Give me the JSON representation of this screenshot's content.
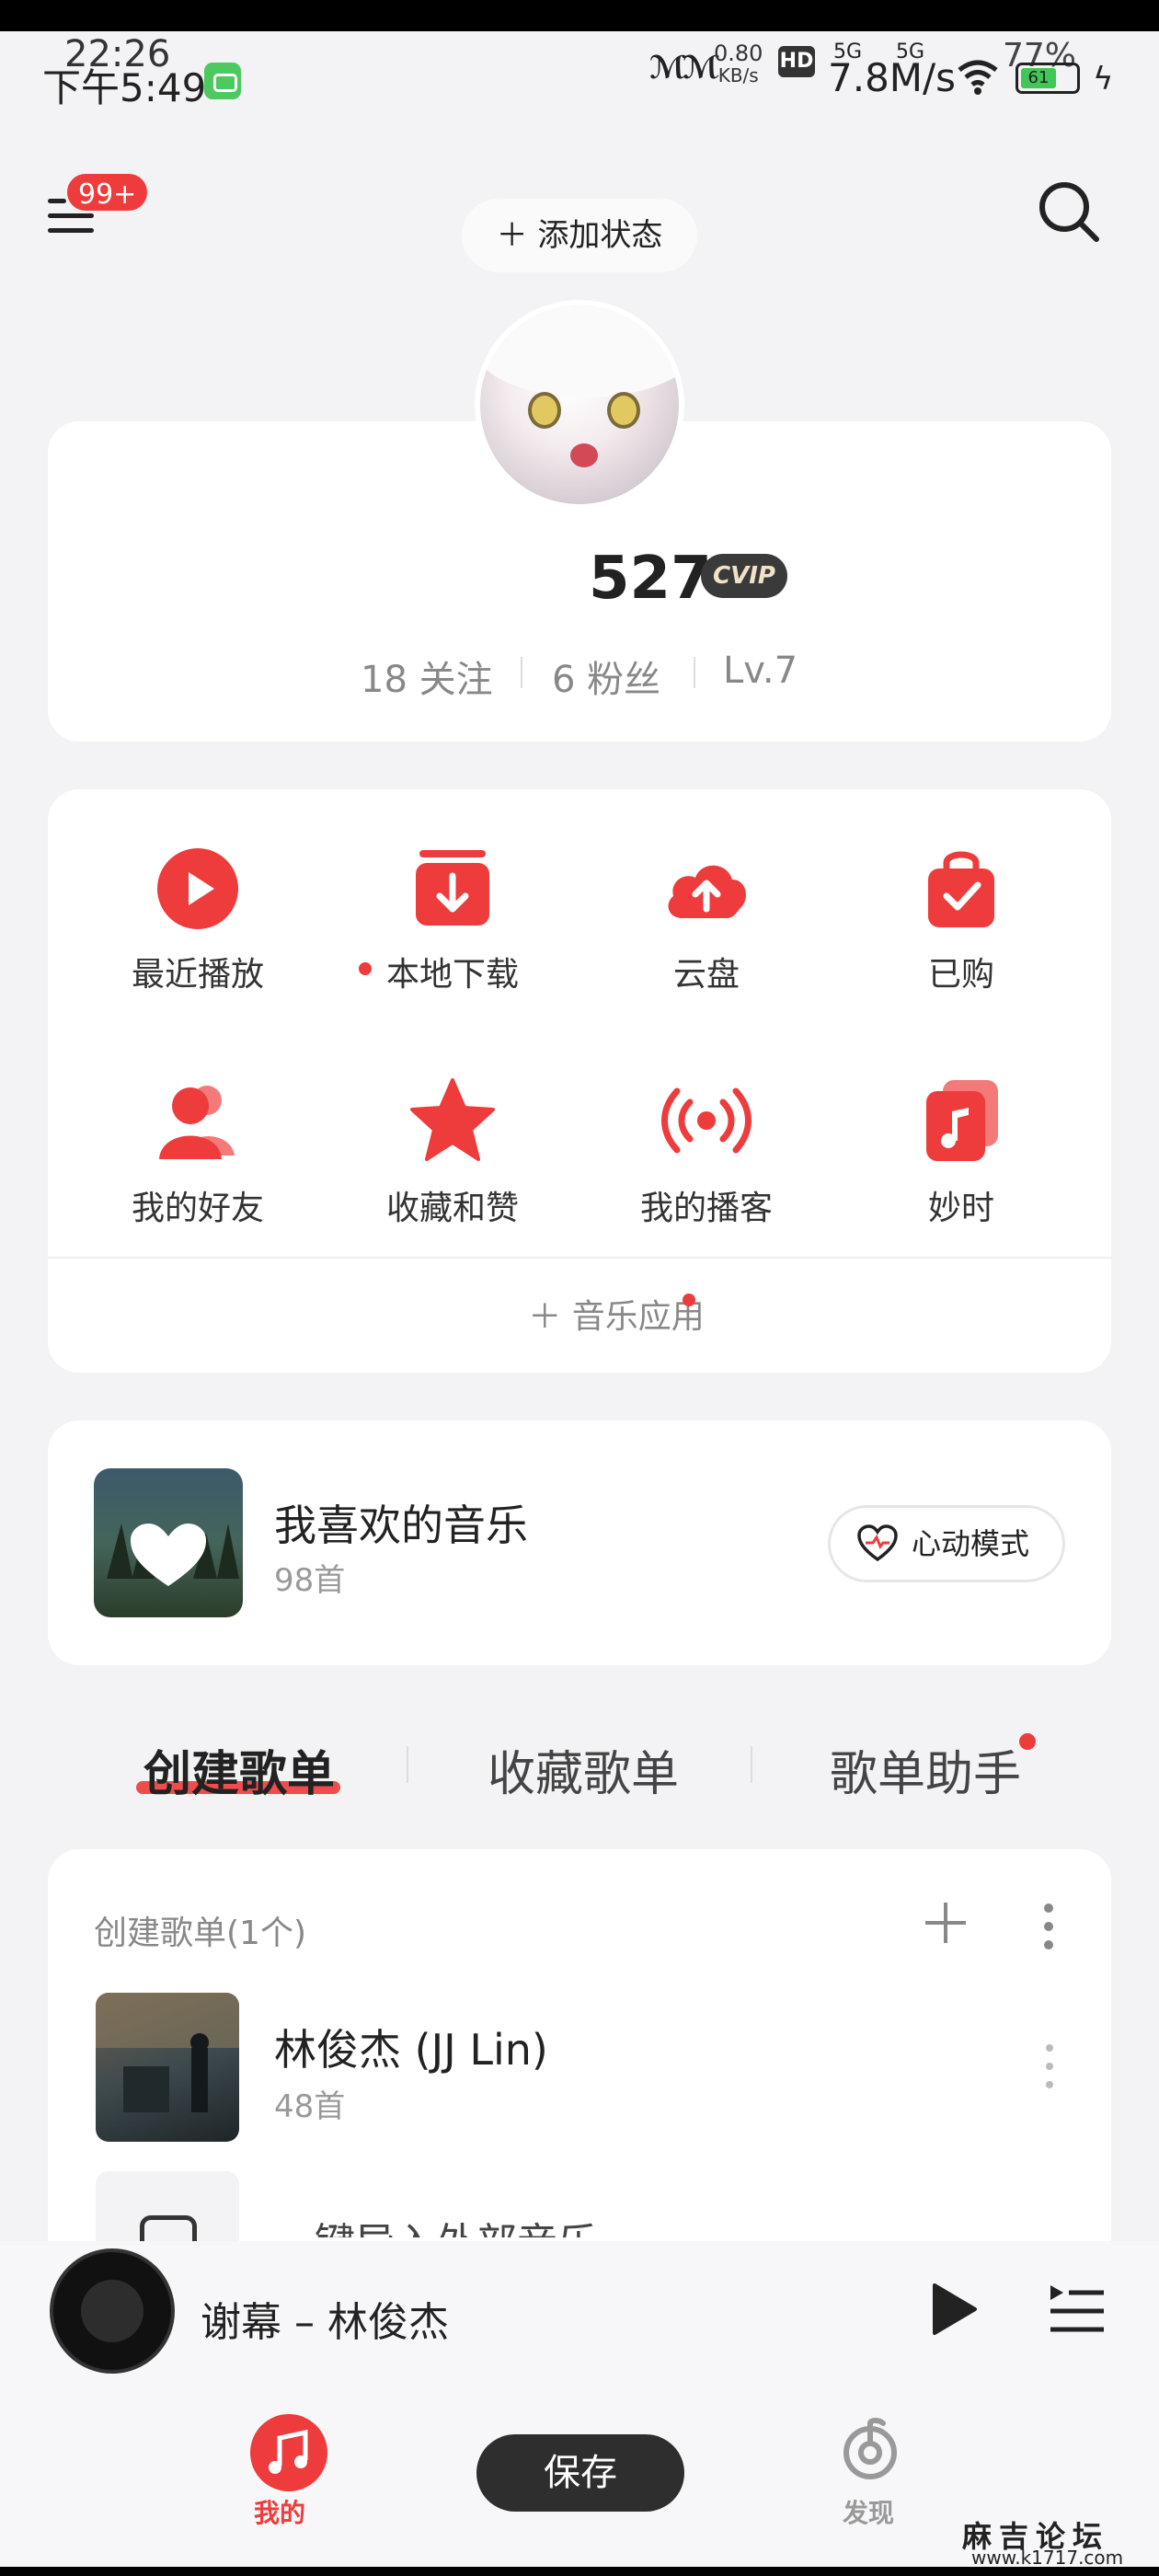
{
  "status_bar": {
    "time_overlay": "22:26",
    "time": "下午5:49",
    "net_speed_value": "0.80",
    "net_speed_unit": "KB/s",
    "hd_label": "HD",
    "sim1": "5G",
    "sim2": "5G",
    "download_speed": "7.8M/s",
    "battery_overlay": "77%",
    "battery_level": "61"
  },
  "header": {
    "notification_badge": "99+",
    "add_status_label": "＋ 添加状态"
  },
  "profile": {
    "name": "527",
    "vip_label": "CVIP",
    "following": "18 关注",
    "followers": "6 粉丝",
    "level": "Lv.7"
  },
  "shortcuts": [
    {
      "label": "最近播放",
      "icon": "play-circle-icon"
    },
    {
      "label": "本地下载",
      "icon": "download-box-icon"
    },
    {
      "label": "云盘",
      "icon": "cloud-upload-icon"
    },
    {
      "label": "已购",
      "icon": "shopping-bag-icon"
    },
    {
      "label": "我的好友",
      "icon": "friends-icon"
    },
    {
      "label": "收藏和赞",
      "icon": "star-icon"
    },
    {
      "label": "我的播客",
      "icon": "broadcast-icon"
    },
    {
      "label": "妙时",
      "icon": "music-note-card-icon"
    }
  ],
  "music_app_label": "＋ 音乐应用",
  "liked_music": {
    "title": "我喜欢的音乐",
    "count": "98首",
    "heart_mode_label": "心动模式"
  },
  "tabs": [
    "创建歌单",
    "收藏歌单",
    "歌单助手"
  ],
  "playlists_section": {
    "header": "创建歌单(1个)",
    "items": [
      {
        "title": "林俊杰 (JJ Lin)",
        "count": "48首"
      }
    ],
    "import_label": "一键导入外部音乐"
  },
  "now_playing": {
    "song": "谢幕 – 林俊杰"
  },
  "bottom_nav": {
    "mine": "我的",
    "discover": "发现",
    "save": "保存"
  },
  "watermark": {
    "name": "麻吉论坛",
    "url": "www.k1717.com"
  },
  "colors": {
    "accent": "#ee3b3b",
    "background": "#f3f3f5",
    "card": "#ffffff"
  }
}
